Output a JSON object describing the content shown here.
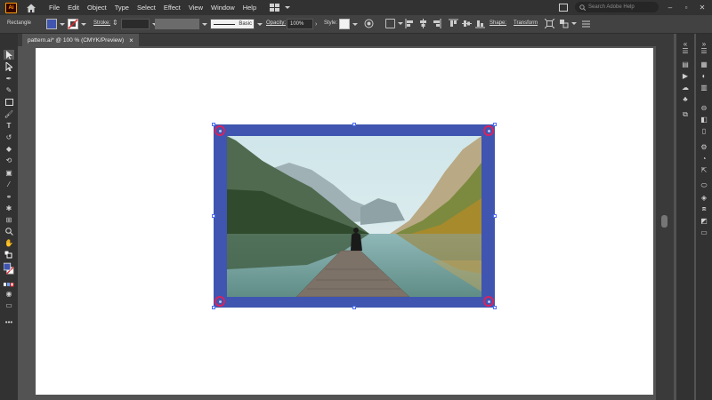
{
  "app": {
    "logo_text": "Ai",
    "menu": [
      "File",
      "Edit",
      "Object",
      "Type",
      "Select",
      "Effect",
      "View",
      "Window",
      "Help"
    ],
    "search_placeholder": "Search Adobe Help"
  },
  "control_bar": {
    "selection_type": "Rectangle",
    "stroke_label": "Stroke:",
    "stroke_profile": "Basic",
    "opacity_label": "Opacity:",
    "opacity_value": "100%",
    "style_label": "Style:",
    "shape_label": "Shape:",
    "transform_label": "Transform",
    "fill_color": "#3f55b0"
  },
  "document": {
    "tab_title": "pattern.ai* @ 100 % (CMYK/Preview)",
    "close_glyph": "×"
  },
  "colors": {
    "accent": "#3f55b0",
    "corner_widget": "#d8235f"
  },
  "icons": {
    "left_tools": [
      "selection-icon",
      "direct-selection-icon",
      "pen-icon",
      "curvature-icon",
      "rectangle-icon",
      "paintbrush-icon",
      "type-icon",
      "rotate-icon",
      "eraser-icon",
      "scale-icon",
      "free-transform-icon",
      "eyedropper-icon",
      "blend-icon",
      "symbol-sprayer-icon",
      "artboard-icon",
      "zoom-icon",
      "hand-icon"
    ],
    "right_panels": [
      "properties-icon",
      "libraries-icon",
      "layers-icon",
      "swatches-icon",
      "brushes-icon",
      "symbols-icon",
      "graphic-styles-icon",
      "appearance-icon",
      "color-icon",
      "stroke-icon",
      "transparency-icon",
      "align-icon",
      "pathfinder-icon"
    ]
  }
}
